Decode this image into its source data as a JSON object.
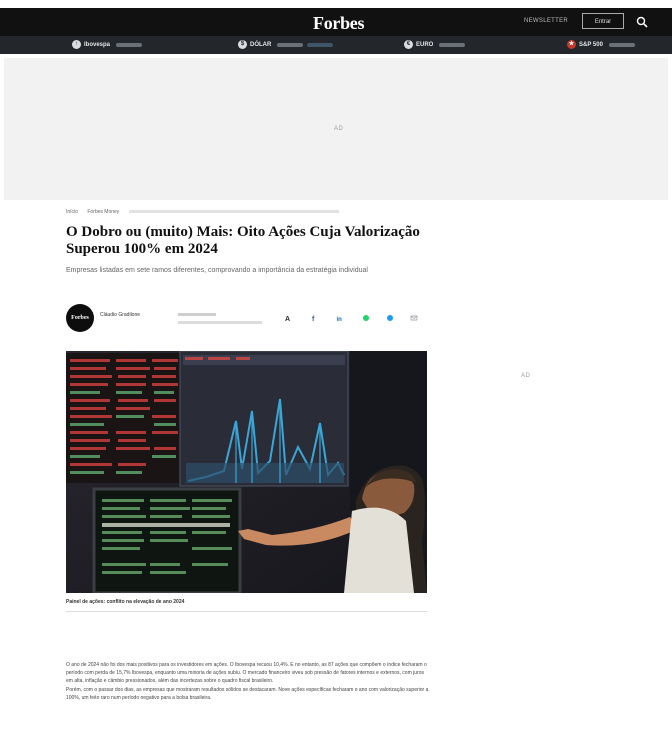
{
  "header": {
    "logo": "Forbes",
    "newsletter_label": "NEWSLETTER",
    "signin_label": "Entrar"
  },
  "ticker": [
    {
      "name": "Ibovespa",
      "icon": "chart-icon",
      "color": "#e5e5e5"
    },
    {
      "name": "DÓLAR",
      "icon": "dollar-icon",
      "color": "#e5e5e5"
    },
    {
      "name": "EURO",
      "icon": "euro-icon",
      "color": "#e5e5e5"
    },
    {
      "name": "S&P 500",
      "icon": "flag-icon",
      "color": "#e5e5e5"
    }
  ],
  "ads": {
    "top_label": "AD",
    "side_label": "AD"
  },
  "breadcrumb": [
    "Início",
    "Forbes Money"
  ],
  "article": {
    "title": "O Dobro ou (muito) Mais: Oito Ações Cuja Valorização Superou 100% em 2024",
    "subtitle": "Empresas listadas em sete ramos diferentes, comprovando a importância da estratégia individual",
    "author": "Cláudio Gradilone",
    "caption": "Painel de ações: conflito na elevação de ano 2024",
    "paragraph_1": "O ano de 2024 não foi dos mais positivos para os investidores em ações. O Ibovespa recuou 10,4%. E no entanto, as 87 ações que compõem o índice fecharam o período com perda de 15,7% Ibovespa, enquanto uma minoria de ações subiu. O mercado financeiro viveu sob pressão de fatores internos e externos, com juros em alta, inflação e câmbio pressionados, além das incertezas sobre o quadro fiscal brasileiro.",
    "paragraph_2": "Porém, com o passar dos dias, as empresas que mostraram resultados sólidos se destacaram. Nove ações específicas fecharam o ano com valorização superior a 100%, um feito raro num período negativo para a bolsa brasileira."
  },
  "colors": {
    "topbar": "#111111",
    "ticker_bar": "#23262b",
    "ad_background": "#f2f2f2",
    "share_colors": [
      "#2a2a2a",
      "#3b5998",
      "#0a66c2",
      "#25d366",
      "#1d9bf0",
      "#c8ccd2"
    ]
  }
}
